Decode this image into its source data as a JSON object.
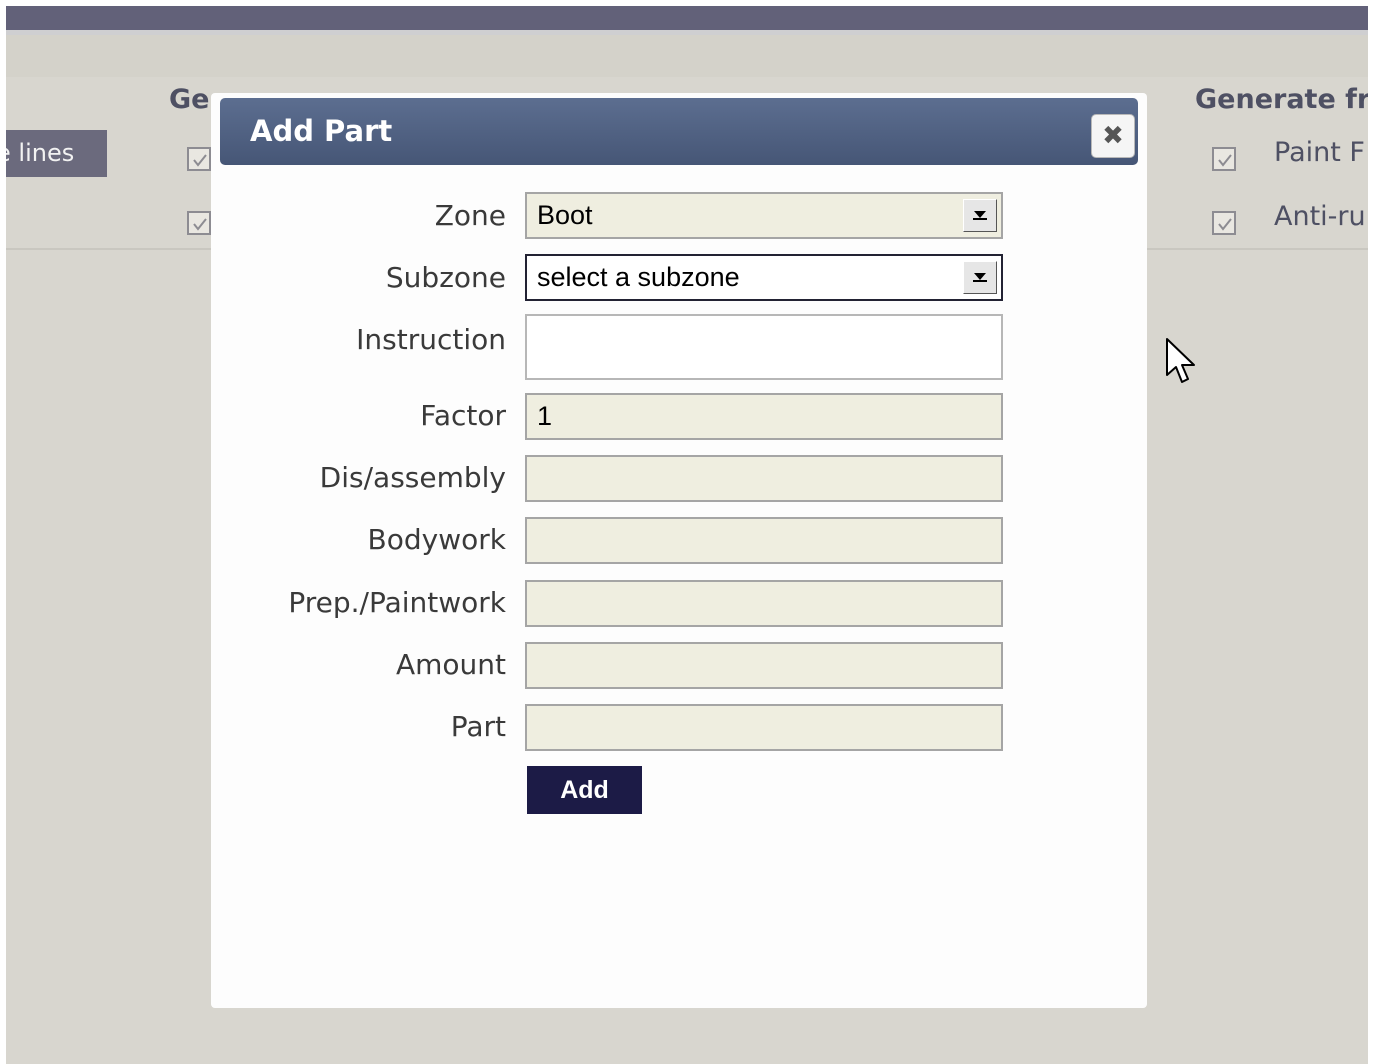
{
  "background": {
    "header_left": "Ge",
    "header_right": "Generate fr",
    "lines_button": "e lines",
    "right_options": [
      {
        "label": "Paint F",
        "checked": true
      },
      {
        "label": "Anti-ru",
        "checked": true
      }
    ],
    "left_checkboxes": [
      true,
      true
    ]
  },
  "dialog": {
    "title": "Add Part",
    "close_icon": "close-icon",
    "fields": {
      "zone": {
        "label": "Zone",
        "value": "Boot"
      },
      "subzone": {
        "label": "Subzone",
        "value": "select a subzone"
      },
      "instruction": {
        "label": "Instruction",
        "value": ""
      },
      "factor": {
        "label": "Factor",
        "value": "1"
      },
      "disassembly": {
        "label": "Dis/assembly",
        "value": ""
      },
      "bodywork": {
        "label": "Bodywork",
        "value": ""
      },
      "paintwork": {
        "label": "Prep./Paintwork",
        "value": ""
      },
      "amount": {
        "label": "Amount",
        "value": ""
      },
      "part": {
        "label": "Part",
        "value": ""
      }
    },
    "add_button": "Add"
  },
  "colors": {
    "title_bar": "#4f5f80",
    "add_button": "#1c1b46",
    "input_background": "#efeee0",
    "page_background": "#d8d6cf"
  }
}
